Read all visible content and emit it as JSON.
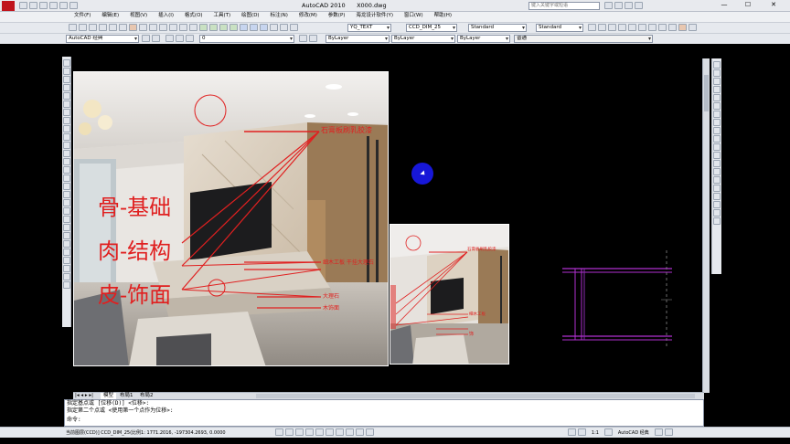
{
  "window": {
    "title": "AutoCAD 2010      X000.dwg",
    "search_placeholder": "键入关键字或短语",
    "min": "—",
    "max": "☐",
    "close": "✕"
  },
  "menu": [
    "文件(F)",
    "编辑(E)",
    "视图(V)",
    "插入(I)",
    "格式(O)",
    "工具(T)",
    "绘图(D)",
    "标注(N)",
    "修改(M)",
    "参数(P)",
    "海龙设计软件(Y)",
    "窗口(W)",
    "帮助(H)"
  ],
  "toolbar": {
    "text_style": "YQ_TEXT",
    "dim_style": "CCD_DIM_25",
    "table_style": "Standard",
    "multileader_style": "Standard",
    "workspace": "AutoCAD 经典",
    "layer": "0",
    "color": "ByLayer",
    "linetype": "ByLayer",
    "lineweight": "ByLayer",
    "plotstyle": "普通"
  },
  "photo_main": {
    "label_top": "石膏板刷乳胶漆",
    "label_1": "骨-基础",
    "label_2": "肉-结构",
    "label_3": "皮-饰面",
    "label_mid": "细木工板  干挂大理石",
    "label_b1": "大理石",
    "label_b2": "木饰面"
  },
  "photo_small": {
    "label_top": "石膏板刷乳胶漆",
    "label_mid": "细木工板",
    "label_b": "饰"
  },
  "tabs": {
    "model": "模型",
    "layout1": "布局1",
    "layout2": "布局2"
  },
  "command": {
    "line1": "指定基点或 [位移(D)] <位移>:",
    "line2": "指定第二个点或 <使用第一个点作为位移>:",
    "prompt": "命令:"
  },
  "status": {
    "left": "当前图层(CCD)] CCD_DIM_25(比例1:   1771.2016,  -197304.2693, 0.0000",
    "scale": "1:1",
    "workspace": "AutoCAD 经典"
  },
  "colors": {
    "accent_red": "#e02020",
    "frame_red": "#c0141c",
    "cad_bg": "#000000",
    "magenta": "#b030d0",
    "cursor_blue": "#1717d8"
  }
}
